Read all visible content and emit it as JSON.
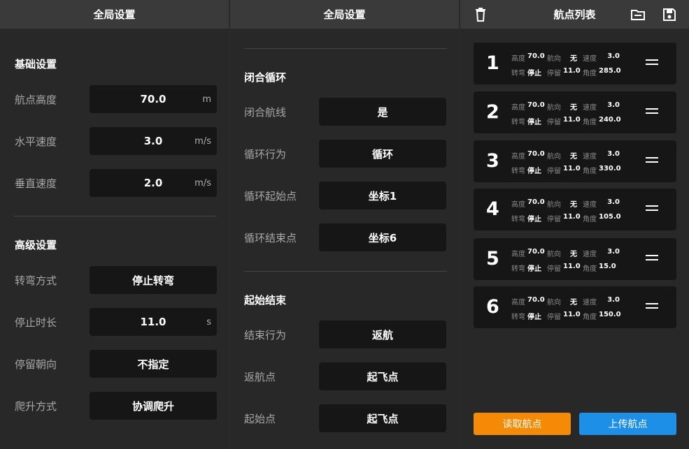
{
  "panel1": {
    "title": "全局设置",
    "basic": {
      "title": "基础设置",
      "rows": [
        {
          "label": "航点高度",
          "value": "70.0",
          "unit": "m"
        },
        {
          "label": "水平速度",
          "value": "3.0",
          "unit": "m/s"
        },
        {
          "label": "垂直速度",
          "value": "2.0",
          "unit": "m/s"
        }
      ]
    },
    "advanced": {
      "title": "高级设置",
      "rows": [
        {
          "label": "转弯方式",
          "value": "停止转弯",
          "unit": ""
        },
        {
          "label": "停止时长",
          "value": "11.0",
          "unit": "s"
        },
        {
          "label": "停留朝向",
          "value": "不指定",
          "unit": ""
        },
        {
          "label": "爬升方式",
          "value": "协调爬升",
          "unit": ""
        }
      ]
    }
  },
  "panel2": {
    "title": "全局设置",
    "loop": {
      "title": "闭合循环",
      "rows": [
        {
          "label": "闭合航线",
          "value": "是"
        },
        {
          "label": "循环行为",
          "value": "循环"
        },
        {
          "label": "循环起始点",
          "value": "坐标1"
        },
        {
          "label": "循环结束点",
          "value": "坐标6"
        }
      ]
    },
    "startend": {
      "title": "起始结束",
      "rows": [
        {
          "label": "结束行为",
          "value": "返航"
        },
        {
          "label": "返航点",
          "value": "起飞点"
        },
        {
          "label": "起始点",
          "value": "起飞点"
        }
      ]
    }
  },
  "panel3": {
    "title": "航点列表",
    "icons": {
      "delete": "trash-icon",
      "folder": "folder-icon",
      "save": "save-icon"
    },
    "keys": {
      "altitude": "高度",
      "heading": "航向",
      "speed": "速度",
      "turn": "转弯",
      "stay": "停留",
      "angle": "角度"
    },
    "waypoints": [
      {
        "num": "1",
        "altitude": "70.0",
        "heading": "无",
        "speed": "3.0",
        "turn": "停止",
        "stay": "11.0",
        "angle": "285.0"
      },
      {
        "num": "2",
        "altitude": "70.0",
        "heading": "无",
        "speed": "3.0",
        "turn": "停止",
        "stay": "11.0",
        "angle": "240.0"
      },
      {
        "num": "3",
        "altitude": "70.0",
        "heading": "无",
        "speed": "3.0",
        "turn": "停止",
        "stay": "11.0",
        "angle": "330.0"
      },
      {
        "num": "4",
        "altitude": "70.0",
        "heading": "无",
        "speed": "3.0",
        "turn": "停止",
        "stay": "11.0",
        "angle": "105.0"
      },
      {
        "num": "5",
        "altitude": "70.0",
        "heading": "无",
        "speed": "3.0",
        "turn": "停止",
        "stay": "11.0",
        "angle": "15.0"
      },
      {
        "num": "6",
        "altitude": "70.0",
        "heading": "无",
        "speed": "3.0",
        "turn": "停止",
        "stay": "11.0",
        "angle": "150.0"
      }
    ],
    "buttons": {
      "read": "读取航点",
      "upload": "上传航点"
    },
    "colors": {
      "read": "#f48a05",
      "upload": "#1e8fe6"
    }
  }
}
